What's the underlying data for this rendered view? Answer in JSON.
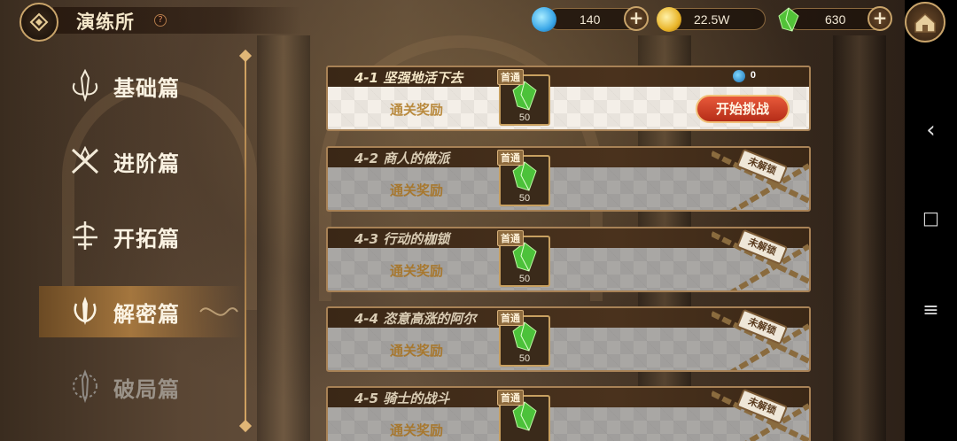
{
  "header": {
    "title": "演练所",
    "help_icon": "?"
  },
  "resources": [
    {
      "name": "blue-orb",
      "value": "140",
      "color": "#3aa7e8"
    },
    {
      "name": "gold-coin",
      "value": "22.5W",
      "color": "#e9b52a"
    },
    {
      "name": "green-crystal",
      "value": "630",
      "color": "#52c238"
    }
  ],
  "sidebar": {
    "items": [
      {
        "label": "基础篇",
        "state": "normal"
      },
      {
        "label": "进阶篇",
        "state": "normal"
      },
      {
        "label": "开拓篇",
        "state": "normal"
      },
      {
        "label": "解密篇",
        "state": "active"
      },
      {
        "label": "破局篇",
        "state": "locked"
      }
    ]
  },
  "stages": [
    {
      "title": "4-1 坚强地活下去",
      "first_clear": "首通",
      "reward_label": "通关奖励",
      "reward_qty": "50",
      "cost": "0",
      "action": "开始挑战",
      "locked": false
    },
    {
      "title": "4-2 商人的做派",
      "first_clear": "首通",
      "reward_label": "通关奖励",
      "reward_qty": "50",
      "lock_text": "未解锁",
      "locked": true
    },
    {
      "title": "4-3 行动的枷锁",
      "first_clear": "首通",
      "reward_label": "通关奖励",
      "reward_qty": "50",
      "lock_text": "未解锁",
      "locked": true
    },
    {
      "title": "4-4 恣意高涨的阿尔",
      "first_clear": "首通",
      "reward_label": "通关奖励",
      "reward_qty": "50",
      "lock_text": "未解锁",
      "locked": true
    },
    {
      "title": "4-5 骑士的战斗",
      "first_clear": "首通",
      "reward_label": "通关奖励",
      "reward_qty": "",
      "lock_text": "未解锁",
      "locked": true
    }
  ],
  "system_nav": {
    "back": "‹",
    "home": "□",
    "menu": "≡"
  },
  "colors": {
    "accent_gold": "#c9a46a",
    "start_button": "#d6442a",
    "active_tab": "#a4763e"
  }
}
